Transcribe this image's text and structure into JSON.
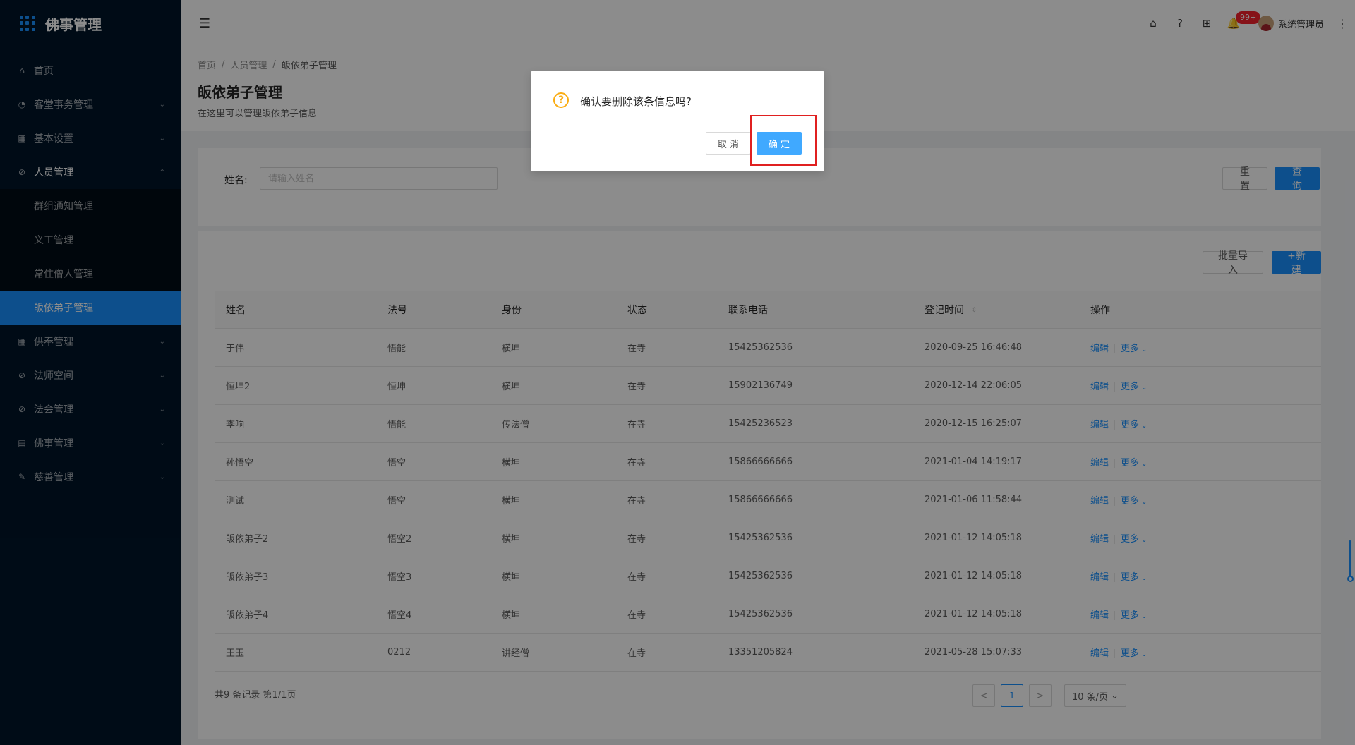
{
  "app": {
    "title": "佛事管理"
  },
  "sidebar": {
    "items": [
      {
        "label": "首页",
        "icon": "home-icon",
        "glyph": "⌂",
        "arrow": ""
      },
      {
        "label": "客堂事务管理",
        "icon": "dashboard-icon",
        "glyph": "◔",
        "arrow": "⌄"
      },
      {
        "label": "基本设置",
        "icon": "table-icon",
        "glyph": "▦",
        "arrow": "⌄"
      },
      {
        "label": "人员管理",
        "icon": "check-circle-icon",
        "glyph": "⊘",
        "arrow": "⌃"
      },
      {
        "label": "供奉管理",
        "icon": "table-icon",
        "glyph": "▦",
        "arrow": "⌄"
      },
      {
        "label": "法师空间",
        "icon": "check-circle-icon",
        "glyph": "⊘",
        "arrow": "⌄"
      },
      {
        "label": "法会管理",
        "icon": "check-circle-icon",
        "glyph": "⊘",
        "arrow": "⌄"
      },
      {
        "label": "佛事管理",
        "icon": "profile-icon",
        "glyph": "▤",
        "arrow": "⌄"
      },
      {
        "label": "慈善管理",
        "icon": "edit-icon",
        "glyph": "✎",
        "arrow": "⌄"
      }
    ],
    "submenu": [
      "群组通知管理",
      "义工管理",
      "常住僧人管理",
      "皈依弟子管理"
    ]
  },
  "header": {
    "collapse_glyph": "☰",
    "icons": {
      "home": "⌂",
      "help": "?",
      "apps": "⊞",
      "bell": "🔔",
      "more": "⋮"
    },
    "badge": "99+",
    "user_name": "系统管理员"
  },
  "page": {
    "breadcrumb": [
      "首页",
      "人员管理",
      "皈依弟子管理"
    ],
    "breadcrumb_sep": "/",
    "title": "皈依弟子管理",
    "description": "在这里可以管理皈依弟子信息"
  },
  "search": {
    "label": "姓名:",
    "placeholder": "请输入姓名",
    "value": "",
    "reset_label": "重 置",
    "query_label": "查 询"
  },
  "toolbar": {
    "import_label": "批量导入",
    "new_label": "+新建"
  },
  "table": {
    "columns": [
      "姓名",
      "法号",
      "身份",
      "状态",
      "联系电话",
      "登记时间",
      "操作"
    ],
    "sort_glyph": "⇕",
    "action_edit": "编辑",
    "action_more": "更多",
    "more_arrow": "⌄",
    "rows": [
      [
        "于伟",
        "悟能",
        "横坤",
        "在寺",
        "15425362536",
        "2020-09-25 16:46:48"
      ],
      [
        "恒坤2",
        "恒坤",
        "横坤",
        "在寺",
        "15902136749",
        "2020-12-14 22:06:05"
      ],
      [
        "李响",
        "悟能",
        "传法僧",
        "在寺",
        "15425236523",
        "2020-12-15 16:25:07"
      ],
      [
        "孙悟空",
        "悟空",
        "横坤",
        "在寺",
        "15866666666",
        "2021-01-04 14:19:17"
      ],
      [
        "测试",
        "悟空",
        "横坤",
        "在寺",
        "15866666666",
        "2021-01-06 11:58:44"
      ],
      [
        "皈依弟子2",
        "悟空2",
        "横坤",
        "在寺",
        "15425362536",
        "2021-01-12 14:05:18"
      ],
      [
        "皈依弟子3",
        "悟空3",
        "横坤",
        "在寺",
        "15425362536",
        "2021-01-12 14:05:18"
      ],
      [
        "皈依弟子4",
        "悟空4",
        "横坤",
        "在寺",
        "15425362536",
        "2021-01-12 14:05:18"
      ],
      [
        "王玉",
        "0212",
        "讲经僧",
        "在寺",
        "13351205824",
        "2021-05-28 15:07:33"
      ]
    ]
  },
  "pagination": {
    "total_text": "共9 条记录 第1/1页",
    "prev": "<",
    "next": ">",
    "current_page": "1",
    "page_size": "10 条/页",
    "size_arrow": "⌄"
  },
  "modal": {
    "icon_glyph": "?",
    "title": "确认要删除该条信息吗?",
    "cancel_label": "取 消",
    "ok_label": "确 定"
  },
  "colors": {
    "primary": "#1890ff",
    "sidebar_bg": "#001529",
    "highlight": "#e02020",
    "warning": "#faad14"
  }
}
